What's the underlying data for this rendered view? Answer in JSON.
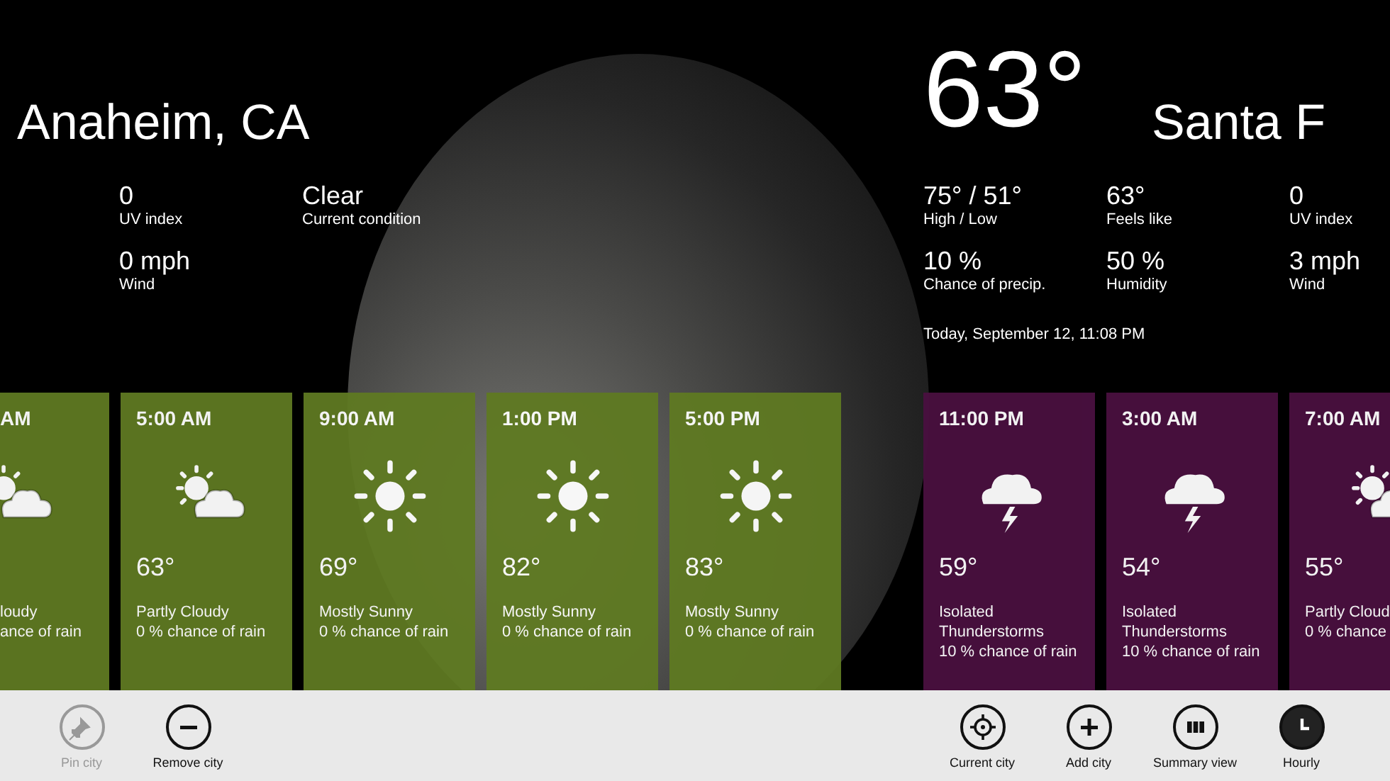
{
  "panes": [
    {
      "city": "Anaheim, CA",
      "stats": [
        {
          "value": "0",
          "label": "UV index"
        },
        {
          "value": "Clear",
          "label": "Current condition"
        },
        {
          "value": "0 mph",
          "label": "Wind"
        }
      ],
      "hours": [
        {
          "time": "AM",
          "kind": "partly_cloudy",
          "condition": "loudy",
          "rain": "ance of rain",
          "color": "#5f7a22"
        },
        {
          "time": "5:00 AM",
          "kind": "partly_cloudy",
          "temperature": "63°",
          "condition": "Partly Cloudy",
          "rain": "0 % chance of rain",
          "color": "#5f7a22"
        },
        {
          "time": "9:00 AM",
          "kind": "sunny",
          "temperature": "69°",
          "condition": "Mostly Sunny",
          "rain": "0 % chance of rain",
          "color": "#5f7a22"
        },
        {
          "time": "1:00 PM",
          "kind": "sunny",
          "temperature": "82°",
          "condition": "Mostly Sunny",
          "rain": "0 % chance of rain",
          "color": "#5f7a22"
        },
        {
          "time": "5:00 PM",
          "kind": "sunny",
          "temperature": "83°",
          "condition": "Mostly Sunny",
          "rain": "0 % chance of rain",
          "color": "#5f7a22"
        }
      ]
    },
    {
      "temperature": "63°",
      "city": "Santa F",
      "stats": [
        {
          "value": "75° / 51°",
          "label": "High / Low"
        },
        {
          "value": "63°",
          "label": "Feels like"
        },
        {
          "value": "0",
          "label": "UV index"
        },
        {
          "value": "10 %",
          "label": "Chance of precip."
        },
        {
          "value": "50 %",
          "label": "Humidity"
        },
        {
          "value": "3 mph",
          "label": "Wind"
        }
      ],
      "updated": "Today, September 12, 11:08 PM",
      "hours": [
        {
          "time": "11:00 PM",
          "kind": "thunderstorm",
          "temperature": "59°",
          "condition": "Isolated Thunderstorms",
          "rain": "10 % chance of rain",
          "color": "#4a1040"
        },
        {
          "time": "3:00 AM",
          "kind": "thunderstorm",
          "temperature": "54°",
          "condition": "Isolated Thunderstorms",
          "rain": "10 % chance of rain",
          "color": "#4a1040"
        },
        {
          "time": "7:00 AM",
          "kind": "partly_cloudy",
          "temperature": "55°",
          "condition": "Partly Cloud",
          "rain": "0 % chance",
          "color": "#4a1040"
        }
      ]
    }
  ],
  "app_bar": {
    "left": [
      {
        "label": "Pin city",
        "kind": "pin",
        "disabled": true,
        "selected": false
      },
      {
        "label": "Remove city",
        "kind": "minus",
        "disabled": false,
        "selected": false
      }
    ],
    "right": [
      {
        "label": "Current city",
        "kind": "target",
        "disabled": false,
        "selected": false
      },
      {
        "label": "Add city",
        "kind": "plus",
        "disabled": false,
        "selected": false
      },
      {
        "label": "Summary view",
        "kind": "columns",
        "disabled": false,
        "selected": false
      },
      {
        "label": "Hourly",
        "kind": "clock",
        "disabled": false,
        "selected": true
      }
    ]
  }
}
